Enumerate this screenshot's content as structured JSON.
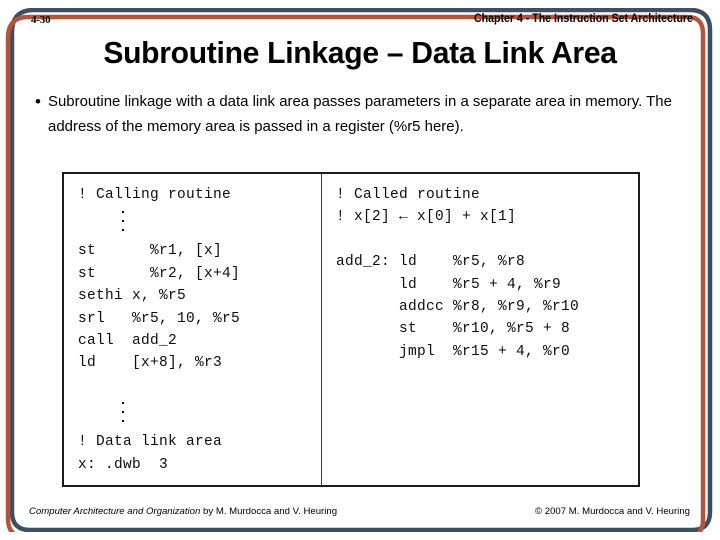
{
  "slide": {
    "page_number": "4-30",
    "chapter_title": "Chapter 4 - The Instruction Set Architecture",
    "title": "Subroutine Linkage – Data Link Area",
    "bullet_marker": "•",
    "bullet_text": "Subroutine linkage with a data link area passes parameters in a separate area in memory.  The address of the memory area is passed in a register (%r5 here)."
  },
  "code_box": {
    "left_column": {
      "lines": [
        "! Calling routine",
        "__VDOTS__",
        "st      %r1, [x]",
        "st      %r2, [x+4]",
        "sethi x, %r5",
        "srl   %r5, 10, %r5",
        "call  add_2",
        "ld    [x+8], %r3",
        "__GAP__",
        "__VDOTS__",
        "! Data link area",
        "x: .dwb  3"
      ]
    },
    "right_column": {
      "lines": [
        "! Called routine",
        "! x[2] ← x[0] + x[1]",
        "__GAP__",
        "add_2: ld    %r5, %r8",
        "       ld    %r5 + 4, %r9",
        "       addcc %r8, %r9, %r10",
        "       st    %r10, %r5 + 8",
        "       jmpl  %r15 + 4, %r0"
      ]
    }
  },
  "footer": {
    "book_title": "Computer Architecture and Organization",
    "byline": " by M. Murdocca and V. Heuring",
    "copyright": "© 2007 M. Murdocca and V. Heuring"
  },
  "theme": {
    "border_outer_color": "#3c4f63",
    "border_inner_color": "#b4543a",
    "code_border_color": "#1a1a1a",
    "text_color": "#000000",
    "background": "#ffffff"
  }
}
